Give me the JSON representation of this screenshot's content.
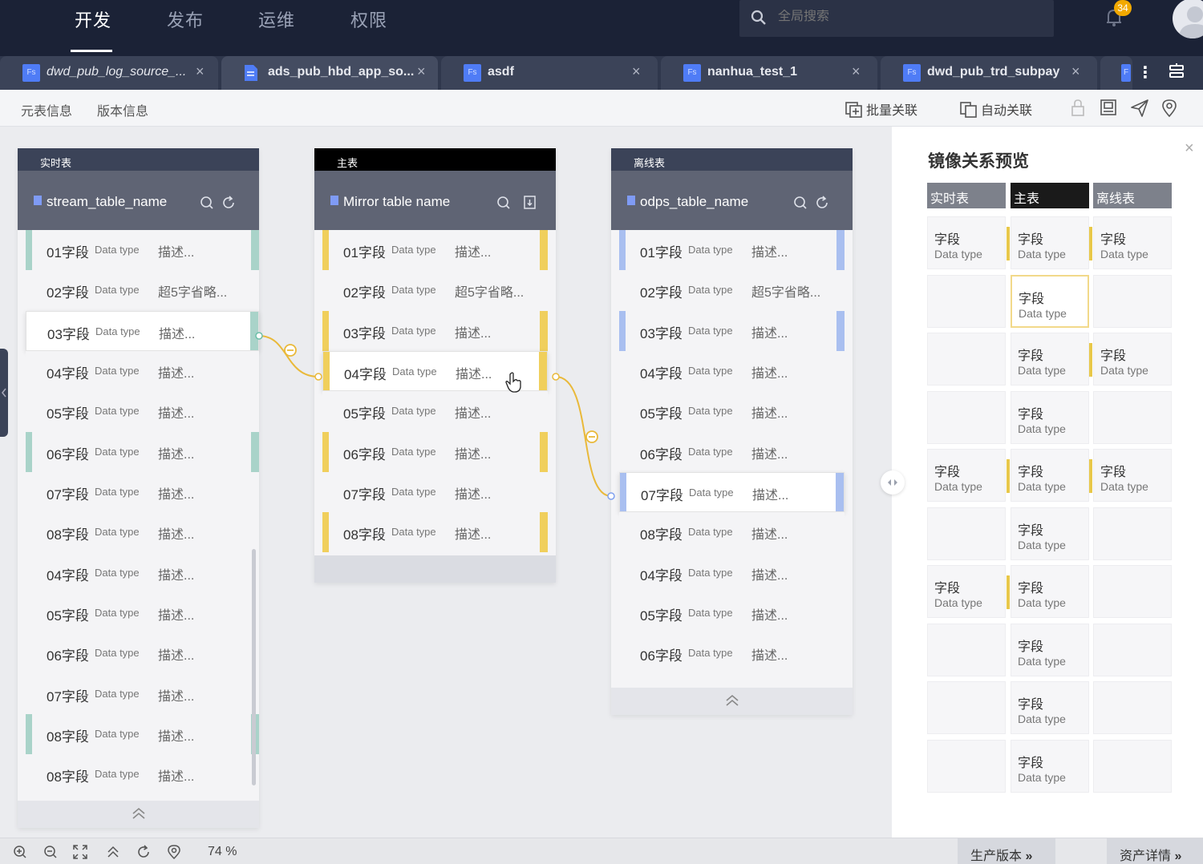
{
  "nav": {
    "items": [
      "开发",
      "发布",
      "运维",
      "权限"
    ]
  },
  "search": {
    "placeholder": "全局搜索"
  },
  "notifications": {
    "count": "34"
  },
  "tabs": [
    {
      "icon": "Fs",
      "label": "dwd_pub_log_source_..."
    },
    {
      "icon": "doc",
      "label": "ads_pub_hbd_app_so..."
    },
    {
      "icon": "Fs",
      "label": "asdf"
    },
    {
      "icon": "Fs",
      "label": "nanhua_test_1"
    },
    {
      "icon": "Fs",
      "label": "dwd_pub_trd_subpay"
    },
    {
      "icon": "F",
      "label": ""
    }
  ],
  "toolbar": {
    "links": [
      "元表信息",
      "版本信息"
    ],
    "batch_link": "批量关联",
    "auto_link": "自动关联"
  },
  "panels": {
    "realtime": {
      "tag": "实时表",
      "name": "stream_table_name",
      "rows": [
        {
          "field": "01字段",
          "type": "Data type",
          "desc": "描述..."
        },
        {
          "field": "02字段",
          "type": "Data type",
          "desc": "超5字省略..."
        },
        {
          "field": "03字段",
          "type": "Data type",
          "desc": "描述..."
        },
        {
          "field": "04字段",
          "type": "Data type",
          "desc": "描述..."
        },
        {
          "field": "05字段",
          "type": "Data type",
          "desc": "描述..."
        },
        {
          "field": "06字段",
          "type": "Data type",
          "desc": "描述..."
        },
        {
          "field": "07字段",
          "type": "Data type",
          "desc": "描述..."
        },
        {
          "field": "08字段",
          "type": "Data type",
          "desc": "描述..."
        },
        {
          "field": "04字段",
          "type": "Data type",
          "desc": "描述..."
        },
        {
          "field": "05字段",
          "type": "Data type",
          "desc": "描述..."
        },
        {
          "field": "06字段",
          "type": "Data type",
          "desc": "描述..."
        },
        {
          "field": "07字段",
          "type": "Data type",
          "desc": "描述..."
        },
        {
          "field": "08字段",
          "type": "Data type",
          "desc": "描述..."
        },
        {
          "field": "08字段",
          "type": "Data type",
          "desc": "描述..."
        }
      ]
    },
    "main": {
      "tag": "主表",
      "name": "Mirror table name",
      "rows": [
        {
          "field": "01字段",
          "type": "Data type",
          "desc": "描述..."
        },
        {
          "field": "02字段",
          "type": "Data type",
          "desc": "超5字省略..."
        },
        {
          "field": "03字段",
          "type": "Data type",
          "desc": "描述..."
        },
        {
          "field": "04字段",
          "type": "Data type",
          "desc": "描述..."
        },
        {
          "field": "05字段",
          "type": "Data type",
          "desc": "描述..."
        },
        {
          "field": "06字段",
          "type": "Data type",
          "desc": "描述..."
        },
        {
          "field": "07字段",
          "type": "Data type",
          "desc": "描述..."
        },
        {
          "field": "08字段",
          "type": "Data type",
          "desc": "描述..."
        }
      ]
    },
    "offline": {
      "tag": "离线表",
      "name": "odps_table_name",
      "rows": [
        {
          "field": "01字段",
          "type": "Data type",
          "desc": "描述..."
        },
        {
          "field": "02字段",
          "type": "Data type",
          "desc": "超5字省略..."
        },
        {
          "field": "03字段",
          "type": "Data type",
          "desc": "描述..."
        },
        {
          "field": "04字段",
          "type": "Data type",
          "desc": "描述..."
        },
        {
          "field": "05字段",
          "type": "Data type",
          "desc": "描述..."
        },
        {
          "field": "06字段",
          "type": "Data type",
          "desc": "描述..."
        },
        {
          "field": "07字段",
          "type": "Data type",
          "desc": "描述..."
        },
        {
          "field": "08字段",
          "type": "Data type",
          "desc": "描述..."
        },
        {
          "field": "04字段",
          "type": "Data type",
          "desc": "描述..."
        },
        {
          "field": "05字段",
          "type": "Data type",
          "desc": "描述..."
        },
        {
          "field": "06字段",
          "type": "Data type",
          "desc": "描述..."
        }
      ]
    }
  },
  "preview": {
    "title": "镜像关系预览",
    "headers": [
      "实时表",
      "主表",
      "离线表"
    ],
    "cell_key": "字段",
    "cell_value": "Data type"
  },
  "bottom": {
    "zoom": "74 %",
    "prod_version": "生产版本",
    "asset_detail": "资产详情"
  },
  "colors": {
    "realtime_accent": "#a9d3c9",
    "main_accent": "#f0cf5c",
    "offline_accent": "#a9bff0",
    "link": "#e9b93a",
    "topbar": "#1b2236"
  }
}
